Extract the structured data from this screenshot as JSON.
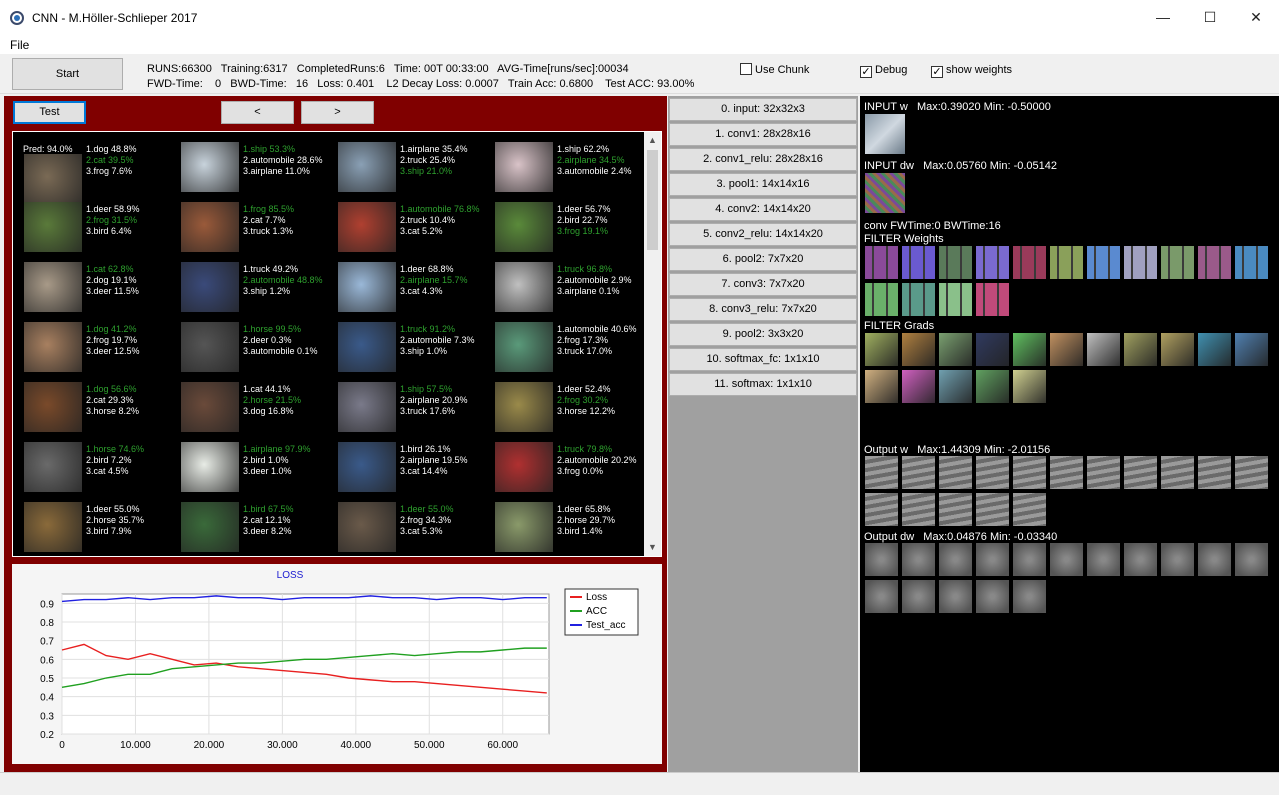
{
  "window": {
    "title": "CNN - M.Höller-Schlieper 2017",
    "minimize": "—",
    "maximize": "☐",
    "close": "✕"
  },
  "menu": {
    "file": "File"
  },
  "toolbar": {
    "start_label": "Start",
    "line1": "RUNS:66300   Training:6317   CompletedRuns:6   Time: 00T 00:33:00   AVG-Time[runs/sec]:00034",
    "line2": "FWD-Time:    0   BWD-Time:   16   Loss: 0.401    L2 Decay Loss: 0.0007   Train Acc: 0.6800    Test ACC: 93.00%",
    "use_chunk": {
      "label": "Use Chunk",
      "checked": false
    },
    "debug": {
      "label": "Debug",
      "checked": true
    },
    "show_weights": {
      "label": "show weights",
      "checked": true
    }
  },
  "nav": {
    "test": "Test",
    "prev": "<",
    "next": ">"
  },
  "grid": {
    "pred_header": "Pred: 94.0%",
    "cells": [
      {
        "c": "#7a6a55",
        "p": [
          [
            "1.dog 48.8%",
            0
          ],
          [
            "2.cat 39.5%",
            1
          ],
          [
            "3.frog 7.6%",
            0
          ]
        ]
      },
      {
        "c": "#c8d3dc",
        "p": [
          [
            "1.ship 53.3%",
            1
          ],
          [
            "2.automobile 28.6%",
            0
          ],
          [
            "3.airplane 11.0%",
            0
          ]
        ]
      },
      {
        "c": "#8aa0b5",
        "p": [
          [
            "1.airplane 35.4%",
            0
          ],
          [
            "2.truck 25.4%",
            0
          ],
          [
            "3.ship 21.0%",
            1
          ]
        ]
      },
      {
        "c": "#d9c3c8",
        "p": [
          [
            "1.ship 62.2%",
            0
          ],
          [
            "2.airplane 34.5%",
            1
          ],
          [
            "3.automobile 2.4%",
            0
          ]
        ]
      },
      {
        "c": "#5a7a3a",
        "p": [
          [
            "1.deer 58.9%",
            0
          ],
          [
            "2.frog 31.5%",
            1
          ],
          [
            "3.bird 6.4%",
            0
          ]
        ]
      },
      {
        "c": "#9a5a3a",
        "p": [
          [
            "1.frog 85.5%",
            1
          ],
          [
            "2.cat 7.7%",
            0
          ],
          [
            "3.truck 1.3%",
            0
          ]
        ]
      },
      {
        "c": "#b04030",
        "p": [
          [
            "1.automobile 76.8%",
            1
          ],
          [
            "2.truck 10.4%",
            0
          ],
          [
            "3.cat 5.2%",
            0
          ]
        ]
      },
      {
        "c": "#5a8a3a",
        "p": [
          [
            "1.deer 56.7%",
            0
          ],
          [
            "2.bird 22.7%",
            0
          ],
          [
            "3.frog 19.1%",
            1
          ]
        ]
      },
      {
        "c": "#a89a88",
        "p": [
          [
            "1.cat 62.8%",
            1
          ],
          [
            "2.dog 19.1%",
            0
          ],
          [
            "3.deer 11.5%",
            0
          ]
        ]
      },
      {
        "c": "#3a4a7a",
        "p": [
          [
            "1.truck 49.2%",
            0
          ],
          [
            "2.automobile 48.8%",
            1
          ],
          [
            "3.ship 1.2%",
            0
          ]
        ]
      },
      {
        "c": "#9ab8d8",
        "p": [
          [
            "1.deer 68.8%",
            0
          ],
          [
            "2.airplane 15.7%",
            1
          ],
          [
            "3.cat 4.3%",
            0
          ]
        ]
      },
      {
        "c": "#c0c0c0",
        "p": [
          [
            "1.truck 96.8%",
            1
          ],
          [
            "2.automobile 2.9%",
            0
          ],
          [
            "3.airplane 0.1%",
            0
          ]
        ]
      },
      {
        "c": "#a88060",
        "p": [
          [
            "1.dog 41.2%",
            1
          ],
          [
            "2.frog 19.7%",
            0
          ],
          [
            "3.deer 12.5%",
            0
          ]
        ]
      },
      {
        "c": "#555555",
        "p": [
          [
            "1.horse 99.5%",
            1
          ],
          [
            "2.deer 0.3%",
            0
          ],
          [
            "3.automobile 0.1%",
            0
          ]
        ]
      },
      {
        "c": "#3a5a8a",
        "p": [
          [
            "1.truck 91.2%",
            1
          ],
          [
            "2.automobile 7.3%",
            0
          ],
          [
            "3.ship 1.0%",
            0
          ]
        ]
      },
      {
        "c": "#5a9a7a",
        "p": [
          [
            "1.automobile 40.6%",
            0
          ],
          [
            "2.frog 17.3%",
            0
          ],
          [
            "3.truck 17.0%",
            0
          ]
        ]
      },
      {
        "c": "#7a4a2a",
        "p": [
          [
            "1.dog 56.6%",
            1
          ],
          [
            "2.cat 29.3%",
            0
          ],
          [
            "3.horse 8.2%",
            0
          ]
        ]
      },
      {
        "c": "#6a4a3a",
        "p": [
          [
            "1.cat 44.1%",
            0
          ],
          [
            "2.horse 21.5%",
            1
          ],
          [
            "3.dog 16.8%",
            0
          ]
        ]
      },
      {
        "c": "#7a7a8a",
        "p": [
          [
            "1.ship 57.5%",
            1
          ],
          [
            "2.airplane 20.9%",
            0
          ],
          [
            "3.truck 17.6%",
            0
          ]
        ]
      },
      {
        "c": "#9a8a4a",
        "p": [
          [
            "1.deer 52.4%",
            0
          ],
          [
            "2.frog 30.2%",
            1
          ],
          [
            "3.horse 12.2%",
            0
          ]
        ]
      },
      {
        "c": "#6a6a6a",
        "p": [
          [
            "1.horse 74.6%",
            1
          ],
          [
            "2.bird 7.2%",
            0
          ],
          [
            "3.cat 4.5%",
            0
          ]
        ]
      },
      {
        "c": "#e8ece6",
        "p": [
          [
            "1.airplane 97.9%",
            1
          ],
          [
            "2.bird 1.0%",
            0
          ],
          [
            "3.deer 1.0%",
            0
          ]
        ]
      },
      {
        "c": "#3a5a8a",
        "p": [
          [
            "1.bird 26.1%",
            0
          ],
          [
            "2.airplane 19.5%",
            0
          ],
          [
            "3.cat 14.4%",
            0
          ]
        ]
      },
      {
        "c": "#b03030",
        "p": [
          [
            "1.truck 79.8%",
            1
          ],
          [
            "2.automobile 20.2%",
            0
          ],
          [
            "3.frog 0.0%",
            0
          ]
        ]
      },
      {
        "c": "#8a6a3a",
        "p": [
          [
            "1.deer 55.0%",
            0
          ],
          [
            "2.horse 35.7%",
            0
          ],
          [
            "3.bird 7.9%",
            0
          ]
        ]
      },
      {
        "c": "#3a6a3a",
        "p": [
          [
            "1.bird 67.5%",
            1
          ],
          [
            "2.cat 12.1%",
            0
          ],
          [
            "3.deer 8.2%",
            0
          ]
        ]
      },
      {
        "c": "#6a5a4a",
        "p": [
          [
            "1.deer 55.0%",
            1
          ],
          [
            "2.frog 34.3%",
            0
          ],
          [
            "3.cat 5.3%",
            0
          ]
        ]
      },
      {
        "c": "#8a9a6a",
        "p": [
          [
            "1.deer 65.8%",
            0
          ],
          [
            "2.horse 29.7%",
            0
          ],
          [
            "3.bird 1.4%",
            0
          ]
        ]
      }
    ]
  },
  "layers": [
    "0. input: 32x32x3",
    "1. conv1: 28x28x16",
    "2. conv1_relu: 28x28x16",
    "3. pool1: 14x14x16",
    "4. conv2: 14x14x20",
    "5. conv2_relu: 14x14x20",
    "6. pool2: 7x7x20",
    "7. conv3: 7x7x20",
    "8. conv3_relu: 7x7x20",
    "9. pool2: 3x3x20",
    "10. softmax_fc: 1x1x10",
    "11. softmax: 1x1x10"
  ],
  "right": {
    "input_w": "INPUT w   Max:0.39020 Min: -0.50000",
    "input_dw": "INPUT dw   Max:0.05760 Min: -0.05142",
    "conv_time": "conv FWTime:0 BWTime:16",
    "filter_weights": "FILTER Weights",
    "filter_grads": "FILTER Grads",
    "output_w": "Output w   Max:1.44309 Min: -2.01156",
    "output_dw": "Output dw   Max:0.04876 Min: -0.03340",
    "weight_colors": [
      "#8a4a9a",
      "#6a5ad0",
      "#5a7a5a",
      "#7a6ad0",
      "#9a3a5a",
      "#8aa05a",
      "#5a8ad0",
      "#a0a0c0",
      "#7a9a6a",
      "#9a5a8a",
      "#4a8ac0",
      "#6ab06a",
      "#5a9a8a",
      "#8ac08a",
      "#c04a7a"
    ],
    "grad_colors": [
      "#a0b060",
      "#b08040",
      "#7aa070",
      "#303a60",
      "#60c060",
      "#c09060",
      "#c0c0c0",
      "#a0a060",
      "#b0a060",
      "#4090b0",
      "#5080b0",
      "#d0b080",
      "#d060c0",
      "#70a0b0",
      "#60a060",
      "#d0d090"
    ]
  },
  "chart_data": {
    "type": "line",
    "title": "LOSS",
    "xlim": [
      0,
      66300
    ],
    "ylim": [
      0.2,
      0.95
    ],
    "x_ticks": [
      "0",
      "10.000",
      "20.000",
      "30.000",
      "40.000",
      "50.000",
      "60.000"
    ],
    "y_ticks": [
      "0.2",
      "0.3",
      "0.4",
      "0.5",
      "0.6",
      "0.7",
      "0.8",
      "0.9"
    ],
    "grid": true,
    "legend": "top-right",
    "series": [
      {
        "name": "Loss",
        "color": "#e82020",
        "x": [
          0,
          3000,
          6000,
          9000,
          12000,
          15000,
          18000,
          21000,
          24000,
          27000,
          30000,
          33000,
          36000,
          39000,
          42000,
          45000,
          48000,
          51000,
          54000,
          57000,
          60000,
          63000,
          66000
        ],
        "values": [
          0.65,
          0.68,
          0.62,
          0.6,
          0.63,
          0.6,
          0.57,
          0.58,
          0.56,
          0.55,
          0.54,
          0.53,
          0.52,
          0.5,
          0.49,
          0.48,
          0.48,
          0.47,
          0.46,
          0.45,
          0.44,
          0.43,
          0.42
        ]
      },
      {
        "name": "ACC",
        "color": "#20a020",
        "x": [
          0,
          3000,
          6000,
          9000,
          12000,
          15000,
          18000,
          21000,
          24000,
          27000,
          30000,
          33000,
          36000,
          39000,
          42000,
          45000,
          48000,
          51000,
          54000,
          57000,
          60000,
          63000,
          66000
        ],
        "values": [
          0.45,
          0.47,
          0.5,
          0.52,
          0.52,
          0.55,
          0.56,
          0.57,
          0.58,
          0.58,
          0.59,
          0.6,
          0.6,
          0.61,
          0.62,
          0.63,
          0.62,
          0.63,
          0.64,
          0.64,
          0.65,
          0.66,
          0.66
        ]
      },
      {
        "name": "Test_acc",
        "color": "#2020e0",
        "x": [
          0,
          3000,
          6000,
          9000,
          12000,
          15000,
          18000,
          21000,
          24000,
          27000,
          30000,
          33000,
          36000,
          39000,
          42000,
          45000,
          48000,
          51000,
          54000,
          57000,
          60000,
          63000,
          66000
        ],
        "values": [
          0.91,
          0.92,
          0.92,
          0.93,
          0.92,
          0.93,
          0.93,
          0.94,
          0.93,
          0.93,
          0.92,
          0.93,
          0.93,
          0.93,
          0.94,
          0.93,
          0.93,
          0.92,
          0.93,
          0.93,
          0.92,
          0.93,
          0.93
        ]
      }
    ]
  }
}
